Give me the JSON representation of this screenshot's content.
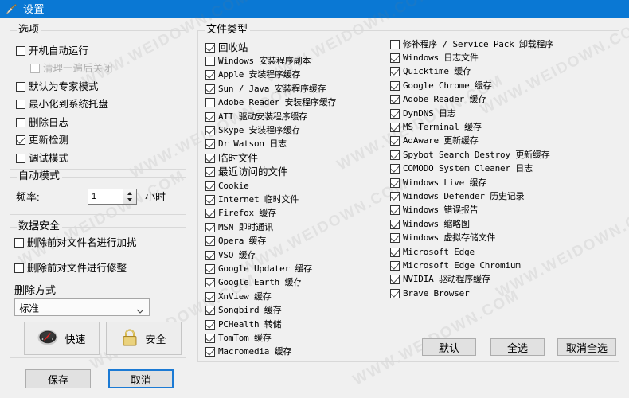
{
  "window": {
    "title": "设置",
    "icon": "broom-icon",
    "titlebar_color": "#0a78d4",
    "background_color": "#f0f0f0"
  },
  "watermark": {
    "text": "WWW.WEIDOWN.COM"
  },
  "options_group": {
    "label": "选项",
    "items": [
      {
        "label": "开机自动运行",
        "checked": false,
        "disabled": false,
        "indent": 0
      },
      {
        "label": "清理一遍后关闭",
        "checked": false,
        "disabled": true,
        "indent": 1
      },
      {
        "label": "默认为专家模式",
        "checked": false,
        "disabled": false,
        "indent": 0
      },
      {
        "label": "最小化到系统托盘",
        "checked": false,
        "disabled": false,
        "indent": 0
      },
      {
        "label": "删除日志",
        "checked": false,
        "disabled": false,
        "indent": 0
      },
      {
        "label": "更新检测",
        "checked": true,
        "disabled": false,
        "indent": 0
      },
      {
        "label": "调试模式",
        "checked": false,
        "disabled": false,
        "indent": 0
      }
    ]
  },
  "auto_mode_group": {
    "label": "自动模式",
    "frequency_label": "频率:",
    "frequency_value": "1",
    "frequency_unit": "小时"
  },
  "data_security_group": {
    "label": "数据安全",
    "items": [
      {
        "label": "删除前对文件名进行加扰",
        "checked": false
      },
      {
        "label": "删除前对文件进行修整",
        "checked": false
      }
    ],
    "delete_method_label": "删除方式",
    "delete_method_value": "标准",
    "mode_buttons": [
      {
        "label": "快速",
        "icon": "speedometer-icon"
      },
      {
        "label": "安全",
        "icon": "padlock-icon"
      }
    ]
  },
  "dialog_buttons": [
    {
      "label": "保存",
      "focused": false
    },
    {
      "label": "取消",
      "focused": true
    }
  ],
  "file_types_group": {
    "label": "文件类型",
    "column_left": [
      {
        "label": "回收站",
        "checked": true,
        "mono": false
      },
      {
        "label": "Windows 安装程序副本",
        "checked": false,
        "mono": true
      },
      {
        "label": "Apple 安装程序缓存",
        "checked": true,
        "mono": true
      },
      {
        "label": "Sun / Java 安装程序缓存",
        "checked": true,
        "mono": true
      },
      {
        "label": "Adobe Reader 安装程序缓存",
        "checked": false,
        "mono": true
      },
      {
        "label": "ATI 驱动安装程序缓存",
        "checked": true,
        "mono": true
      },
      {
        "label": "Skype 安装程序缓存",
        "checked": true,
        "mono": true
      },
      {
        "label": "Dr Watson 日志",
        "checked": true,
        "mono": true
      },
      {
        "label": "临时文件",
        "checked": true,
        "mono": false
      },
      {
        "label": "最近访问的文件",
        "checked": true,
        "mono": false
      },
      {
        "label": "Cookie",
        "checked": true,
        "mono": true
      },
      {
        "label": "Internet 临时文件",
        "checked": true,
        "mono": true
      },
      {
        "label": "Firefox 缓存",
        "checked": true,
        "mono": true
      },
      {
        "label": "MSN 即时通讯",
        "checked": true,
        "mono": true
      },
      {
        "label": "Opera 缓存",
        "checked": true,
        "mono": true
      },
      {
        "label": "VSO 缓存",
        "checked": true,
        "mono": true
      },
      {
        "label": "Google Updater 缓存",
        "checked": true,
        "mono": true
      },
      {
        "label": "Google Earth 缓存",
        "checked": true,
        "mono": true
      },
      {
        "label": "XnView 缓存",
        "checked": true,
        "mono": true
      },
      {
        "label": "Songbird 缓存",
        "checked": true,
        "mono": true
      },
      {
        "label": "PCHealth 转储",
        "checked": true,
        "mono": true
      },
      {
        "label": "TomTom 缓存",
        "checked": true,
        "mono": true
      },
      {
        "label": "Macromedia 缓存",
        "checked": true,
        "mono": true
      }
    ],
    "column_right": [
      {
        "label": "修补程序 / Service Pack 卸载程序",
        "checked": false,
        "mono": true
      },
      {
        "label": "Windows 日志文件",
        "checked": true,
        "mono": true
      },
      {
        "label": "Quicktime 缓存",
        "checked": true,
        "mono": true
      },
      {
        "label": "Google Chrome 缓存",
        "checked": true,
        "mono": true
      },
      {
        "label": "Adobe Reader 缓存",
        "checked": true,
        "mono": true
      },
      {
        "label": "DynDNS 日志",
        "checked": true,
        "mono": true
      },
      {
        "label": "MS Terminal 缓存",
        "checked": true,
        "mono": true
      },
      {
        "label": "AdAware 更新缓存",
        "checked": true,
        "mono": true
      },
      {
        "label": "Spybot Search  Destroy 更新缓存",
        "checked": true,
        "mono": true
      },
      {
        "label": "COMODO System Cleaner 日志",
        "checked": true,
        "mono": true
      },
      {
        "label": "Windows Live 缓存",
        "checked": true,
        "mono": true
      },
      {
        "label": "Windows Defender 历史记录",
        "checked": true,
        "mono": true
      },
      {
        "label": "Windows 错误报告",
        "checked": true,
        "mono": true
      },
      {
        "label": "Windows 缩略图",
        "checked": true,
        "mono": true
      },
      {
        "label": "Windows 虚拟存储文件",
        "checked": true,
        "mono": true
      },
      {
        "label": "Microsoft Edge",
        "checked": true,
        "mono": true
      },
      {
        "label": "Microsoft Edge Chromium",
        "checked": true,
        "mono": true
      },
      {
        "label": "NVIDIA 驱动程序缓存",
        "checked": true,
        "mono": true
      },
      {
        "label": "Brave Browser",
        "checked": true,
        "mono": true
      }
    ],
    "action_buttons": [
      {
        "label": "默认"
      },
      {
        "label": "全选"
      },
      {
        "label": "取消全选"
      }
    ]
  }
}
